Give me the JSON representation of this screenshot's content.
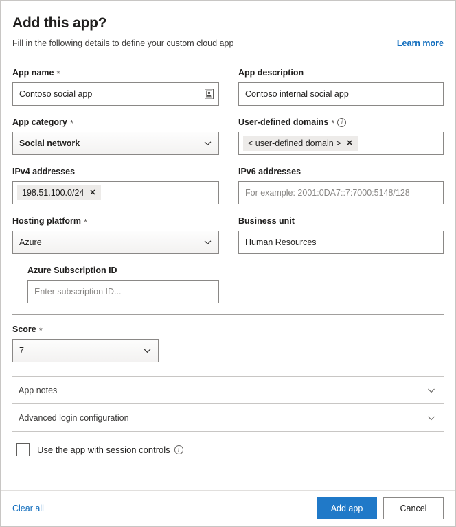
{
  "header": {
    "title": "Add this app?",
    "subtitle": "Fill in the following details to define your custom cloud app",
    "learn_more": "Learn more"
  },
  "form": {
    "app_name": {
      "label": "App name",
      "required": true,
      "value": "Contoso social app",
      "icon": "contact-card-icon"
    },
    "app_description": {
      "label": "App description",
      "required": false,
      "value": "Contoso internal social app"
    },
    "app_category": {
      "label": "App category",
      "required": true,
      "selected": "Social network"
    },
    "user_defined_domains": {
      "label": "User-defined domains",
      "required": true,
      "has_info": true,
      "tags": [
        "< user-defined domain >"
      ]
    },
    "ipv4_addresses": {
      "label": "IPv4 addresses",
      "required": false,
      "tags": [
        "198.51.100.0/24"
      ]
    },
    "ipv6_addresses": {
      "label": "IPv6 addresses",
      "required": false,
      "value": "",
      "placeholder": "For example: 2001:0DA7::7:7000:5148/128"
    },
    "hosting_platform": {
      "label": "Hosting platform",
      "required": true,
      "selected": "Azure"
    },
    "business_unit": {
      "label": "Business unit",
      "required": false,
      "value": "Human Resources"
    },
    "azure_subscription_id": {
      "label": "Azure Subscription ID",
      "required": false,
      "value": "",
      "placeholder": "Enter subscription ID..."
    },
    "score": {
      "label": "Score",
      "required": true,
      "selected": "7"
    }
  },
  "accordions": [
    {
      "label": "App notes",
      "expanded": false
    },
    {
      "label": "Advanced login configuration",
      "expanded": false
    }
  ],
  "session_controls": {
    "label": "Use the app with session controls",
    "checked": false,
    "has_info": true
  },
  "footer": {
    "clear_all": "Clear all",
    "primary_button": "Add app",
    "secondary_button": "Cancel"
  },
  "symbols": {
    "required_mark": "*",
    "info": "i",
    "tag_remove": "✕"
  },
  "colors": {
    "accent_blue": "#2079c8",
    "link_blue": "#0f6cbd",
    "border": "#8a8886",
    "tag_bg": "#edebe9",
    "text": "#201f1e",
    "muted_text": "#605e5c"
  }
}
